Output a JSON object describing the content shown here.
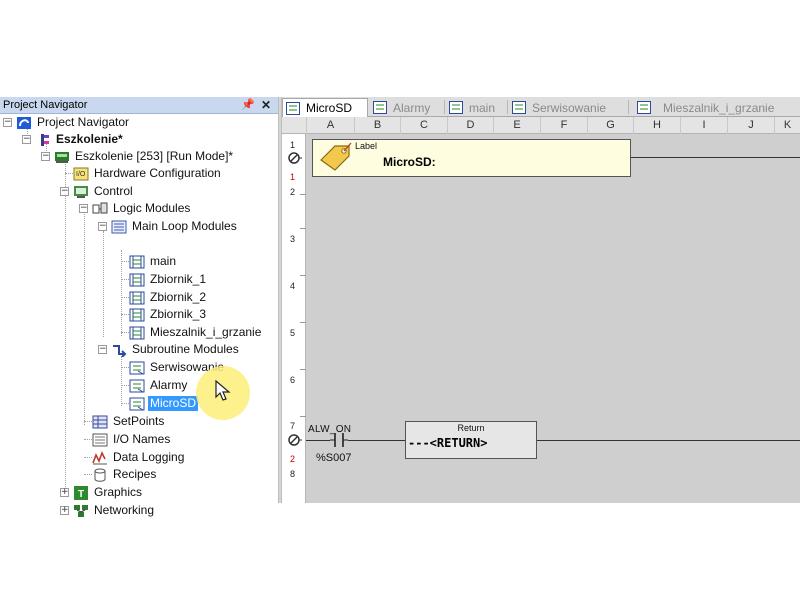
{
  "navigator": {
    "title": "Project Navigator",
    "pin_glyph": "📌",
    "close_glyph": "✕",
    "tree": {
      "root": "Project Navigator",
      "project": "Eszkolenie*",
      "controller": "Eszkolenie [253] [Run Mode]*",
      "hardware": "Hardware Configuration",
      "control": "Control",
      "logic_modules": "Logic Modules",
      "main_loop": "Main Loop Modules",
      "main_loop_items": [
        "main",
        "Zbiornik_1",
        "Zbiornik_2",
        "Zbiornik_3",
        "Mieszalnik_i_grzanie"
      ],
      "subroutine": "Subroutine Modules",
      "subroutine_items": [
        "Serwisowanie",
        "Alarmy",
        "MicroSD"
      ],
      "setpoints": "SetPoints",
      "io_names": "I/O Names",
      "data_logging": "Data Logging",
      "recipes": "Recipes",
      "graphics": "Graphics",
      "networking": "Networking"
    }
  },
  "editor": {
    "tabs": [
      "MicroSD",
      "Alarmy",
      "main",
      "Serwisowanie",
      "Mieszalnik_i_grzanie"
    ],
    "active_tab": "MicroSD",
    "columns": [
      "A",
      "B",
      "C",
      "D",
      "E",
      "F",
      "G",
      "H",
      "I",
      "J",
      "K"
    ],
    "rows": {
      "r1": "1",
      "r1b": "1",
      "r2": "2",
      "r3": "3",
      "r4": "4",
      "r5": "5",
      "r6": "6",
      "r7": "7",
      "r7b": "2",
      "r8": "8"
    },
    "label_block": {
      "caption": "Label",
      "text": "MicroSD:"
    },
    "contact": {
      "name": "ALW_ON",
      "address": "%S007"
    },
    "return_block": {
      "caption": "Return",
      "text": "---<RETURN>"
    }
  },
  "colors": {
    "header_bg": "#c9d8ee",
    "selection": "#3399ff",
    "grid_bg": "#cfcfcf",
    "label_bg": "#fffde0",
    "cursor_halo": "#fcee78"
  }
}
